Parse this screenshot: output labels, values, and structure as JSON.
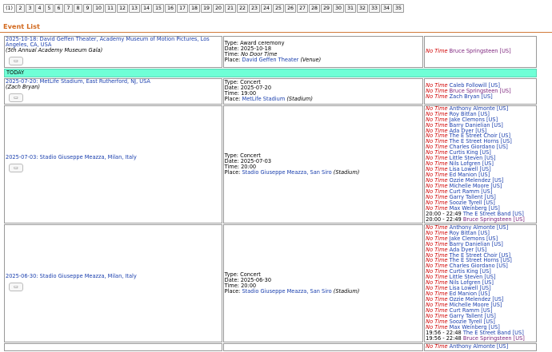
{
  "pager": {
    "pages": [
      "(1)",
      "2",
      "3",
      "4",
      "5",
      "6",
      "7",
      "8",
      "9",
      "10",
      "11",
      "12",
      "13",
      "14",
      "15",
      "16",
      "17",
      "18",
      "19",
      "20",
      "21",
      "22",
      "23",
      "24",
      "25",
      "26",
      "27",
      "28",
      "29",
      "30",
      "31",
      "32",
      "33",
      "34",
      "35"
    ]
  },
  "section_title": "Event List",
  "today_label": "TODAY",
  "calendar_icon": "calendar-icon",
  "events": [
    {
      "date_venue": "2025-10-18: David Geffen Theater, Academy Museum of Motion Pictures, Los Angeles, CA, USA",
      "subtitle": "(5th Annual Academy Museum Gala)",
      "type": "Type: Award ceremony",
      "date": "Date: 2025-10-18",
      "time_prefix": "Time: ",
      "time_value": "No Door Time",
      "place_prefix": "Place: ",
      "place_link": "David Geffen Theater",
      "place_suffix": " (Venue)",
      "performers": [
        {
          "time": "No Time",
          "name": "Bruce Springsteen [US]",
          "head": true
        }
      ]
    },
    {
      "date_venue": "2025-07-20: MetLife Stadium, East Rutherford, NJ, USA",
      "subtitle": "(Zach Bryan)",
      "type": "Type: Concert",
      "date": "Date: 2025-07-20",
      "time_prefix": "Time: ",
      "time_value": "19:00",
      "place_prefix": "Place: ",
      "place_link": "MetLife Stadium",
      "place_suffix": " (Stadium)",
      "performers": [
        {
          "time": "No Time",
          "name": "Caleb Followill [US]"
        },
        {
          "time": "No Time",
          "name": "Bruce Springsteen [US]",
          "head": true
        },
        {
          "time": "No Time",
          "name": "Zach Bryan [US]"
        }
      ]
    },
    {
      "date_venue": "2025-07-03: Stadio Giuseppe Meazza, Milan, Italy",
      "subtitle": "",
      "type": "Type: Concert",
      "date": "Date: 2025-07-03",
      "time_prefix": "Time: ",
      "time_value": "20:00",
      "place_prefix": "Place: ",
      "place_link": "Stadio Giuseppe Meazza, San Siro",
      "place_suffix": " (Stadium)",
      "performers": [
        {
          "time": "No Time",
          "name": "Anthony Almonte [US]"
        },
        {
          "time": "No Time",
          "name": "Roy Bittan [US]"
        },
        {
          "time": "No Time",
          "name": "Jake Clemons [US]"
        },
        {
          "time": "No Time",
          "name": "Barry Danielian [US]"
        },
        {
          "time": "No Time",
          "name": "Ada Dyer [US]"
        },
        {
          "time": "No Time",
          "name": "The E Street Choir [US]"
        },
        {
          "time": "No Time",
          "name": "The E Street Horns [US]"
        },
        {
          "time": "No Time",
          "name": "Charles Giordano [US]"
        },
        {
          "time": "No Time",
          "name": "Curtis King [US]"
        },
        {
          "time": "No Time",
          "name": "Little Steven [US]"
        },
        {
          "time": "No Time",
          "name": "Nils Lofgren [US]"
        },
        {
          "time": "No Time",
          "name": "Lisa Lowell [US]"
        },
        {
          "time": "No Time",
          "name": "Ed Manion [US]"
        },
        {
          "time": "No Time",
          "name": "Ozzie Melendez [US]"
        },
        {
          "time": "No Time",
          "name": "Michelle Moore [US]"
        },
        {
          "time": "No Time",
          "name": "Curt Ramm [US]"
        },
        {
          "time": "No Time",
          "name": "Garry Tallent [US]"
        },
        {
          "time": "No Time",
          "name": "Soozie Tyrell [US]"
        },
        {
          "time": "No Time",
          "name": "Max Weinberg [US]"
        },
        {
          "time": "20:00 - 22:49",
          "name": "The E Street Band [US]",
          "plain": true
        },
        {
          "time": "20:00 - 22:49",
          "name": "Bruce Springsteen [US]",
          "plain": true,
          "head": true
        }
      ]
    },
    {
      "date_venue": "2025-06-30: Stadio Giuseppe Meazza, Milan, Italy",
      "subtitle": "",
      "type": "Type: Concert",
      "date": "Date: 2025-06-30",
      "time_prefix": "Time: ",
      "time_value": "20:00",
      "place_prefix": "Place: ",
      "place_link": "Stadio Giuseppe Meazza, San Siro",
      "place_suffix": " (Stadium)",
      "performers": [
        {
          "time": "No Time",
          "name": "Anthony Almonte [US]"
        },
        {
          "time": "No Time",
          "name": "Roy Bittan [US]"
        },
        {
          "time": "No Time",
          "name": "Jake Clemons [US]"
        },
        {
          "time": "No Time",
          "name": "Barry Danielian [US]"
        },
        {
          "time": "No Time",
          "name": "Ada Dyer [US]"
        },
        {
          "time": "No Time",
          "name": "The E Street Choir [US]"
        },
        {
          "time": "No Time",
          "name": "The E Street Horns [US]"
        },
        {
          "time": "No Time",
          "name": "Charles Giordano [US]"
        },
        {
          "time": "No Time",
          "name": "Curtis King [US]"
        },
        {
          "time": "No Time",
          "name": "Little Steven [US]"
        },
        {
          "time": "No Time",
          "name": "Nils Lofgren [US]"
        },
        {
          "time": "No Time",
          "name": "Lisa Lowell [US]"
        },
        {
          "time": "No Time",
          "name": "Ed Manion [US]"
        },
        {
          "time": "No Time",
          "name": "Ozzie Melendez [US]"
        },
        {
          "time": "No Time",
          "name": "Michelle Moore [US]"
        },
        {
          "time": "No Time",
          "name": "Curt Ramm [US]"
        },
        {
          "time": "No Time",
          "name": "Garry Tallent [US]"
        },
        {
          "time": "No Time",
          "name": "Soozie Tyrell [US]"
        },
        {
          "time": "No Time",
          "name": "Max Weinberg [US]"
        },
        {
          "time": "19:56 - 22:48",
          "name": "The E Street Band [US]",
          "plain": true
        },
        {
          "time": "19:56 - 22:48",
          "name": "Bruce Springsteen [US]",
          "plain": true,
          "head": true
        }
      ]
    },
    {
      "date_venue": "",
      "subtitle": "",
      "type": "",
      "date": "",
      "time_prefix": "",
      "time_value": "",
      "place_prefix": "",
      "place_link": "",
      "place_suffix": "",
      "performers": [
        {
          "time": "No Time",
          "name": "Anthony Almonte [US]"
        }
      ]
    }
  ]
}
